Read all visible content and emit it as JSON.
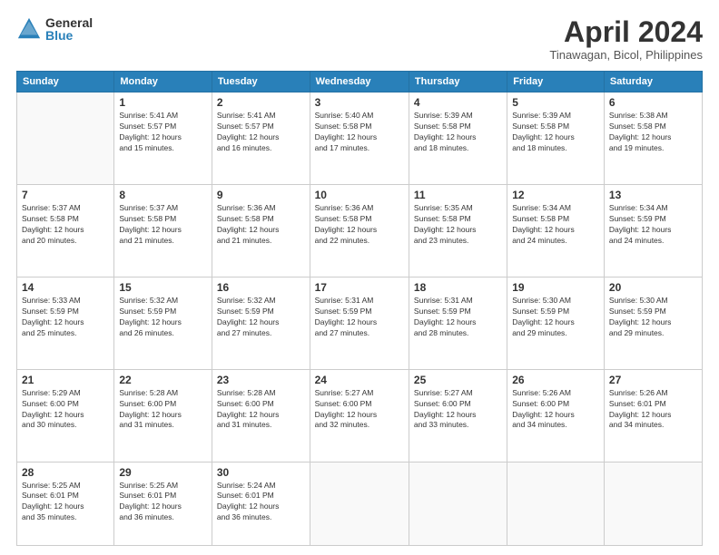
{
  "logo": {
    "general": "General",
    "blue": "Blue"
  },
  "title": "April 2024",
  "location": "Tinawagan, Bicol, Philippines",
  "days_of_week": [
    "Sunday",
    "Monday",
    "Tuesday",
    "Wednesday",
    "Thursday",
    "Friday",
    "Saturday"
  ],
  "weeks": [
    [
      {
        "day": "",
        "info": ""
      },
      {
        "day": "1",
        "info": "Sunrise: 5:41 AM\nSunset: 5:57 PM\nDaylight: 12 hours\nand 15 minutes."
      },
      {
        "day": "2",
        "info": "Sunrise: 5:41 AM\nSunset: 5:57 PM\nDaylight: 12 hours\nand 16 minutes."
      },
      {
        "day": "3",
        "info": "Sunrise: 5:40 AM\nSunset: 5:58 PM\nDaylight: 12 hours\nand 17 minutes."
      },
      {
        "day": "4",
        "info": "Sunrise: 5:39 AM\nSunset: 5:58 PM\nDaylight: 12 hours\nand 18 minutes."
      },
      {
        "day": "5",
        "info": "Sunrise: 5:39 AM\nSunset: 5:58 PM\nDaylight: 12 hours\nand 18 minutes."
      },
      {
        "day": "6",
        "info": "Sunrise: 5:38 AM\nSunset: 5:58 PM\nDaylight: 12 hours\nand 19 minutes."
      }
    ],
    [
      {
        "day": "7",
        "info": "Sunrise: 5:37 AM\nSunset: 5:58 PM\nDaylight: 12 hours\nand 20 minutes."
      },
      {
        "day": "8",
        "info": "Sunrise: 5:37 AM\nSunset: 5:58 PM\nDaylight: 12 hours\nand 21 minutes."
      },
      {
        "day": "9",
        "info": "Sunrise: 5:36 AM\nSunset: 5:58 PM\nDaylight: 12 hours\nand 21 minutes."
      },
      {
        "day": "10",
        "info": "Sunrise: 5:36 AM\nSunset: 5:58 PM\nDaylight: 12 hours\nand 22 minutes."
      },
      {
        "day": "11",
        "info": "Sunrise: 5:35 AM\nSunset: 5:58 PM\nDaylight: 12 hours\nand 23 minutes."
      },
      {
        "day": "12",
        "info": "Sunrise: 5:34 AM\nSunset: 5:58 PM\nDaylight: 12 hours\nand 24 minutes."
      },
      {
        "day": "13",
        "info": "Sunrise: 5:34 AM\nSunset: 5:59 PM\nDaylight: 12 hours\nand 24 minutes."
      }
    ],
    [
      {
        "day": "14",
        "info": "Sunrise: 5:33 AM\nSunset: 5:59 PM\nDaylight: 12 hours\nand 25 minutes."
      },
      {
        "day": "15",
        "info": "Sunrise: 5:32 AM\nSunset: 5:59 PM\nDaylight: 12 hours\nand 26 minutes."
      },
      {
        "day": "16",
        "info": "Sunrise: 5:32 AM\nSunset: 5:59 PM\nDaylight: 12 hours\nand 27 minutes."
      },
      {
        "day": "17",
        "info": "Sunrise: 5:31 AM\nSunset: 5:59 PM\nDaylight: 12 hours\nand 27 minutes."
      },
      {
        "day": "18",
        "info": "Sunrise: 5:31 AM\nSunset: 5:59 PM\nDaylight: 12 hours\nand 28 minutes."
      },
      {
        "day": "19",
        "info": "Sunrise: 5:30 AM\nSunset: 5:59 PM\nDaylight: 12 hours\nand 29 minutes."
      },
      {
        "day": "20",
        "info": "Sunrise: 5:30 AM\nSunset: 5:59 PM\nDaylight: 12 hours\nand 29 minutes."
      }
    ],
    [
      {
        "day": "21",
        "info": "Sunrise: 5:29 AM\nSunset: 6:00 PM\nDaylight: 12 hours\nand 30 minutes."
      },
      {
        "day": "22",
        "info": "Sunrise: 5:28 AM\nSunset: 6:00 PM\nDaylight: 12 hours\nand 31 minutes."
      },
      {
        "day": "23",
        "info": "Sunrise: 5:28 AM\nSunset: 6:00 PM\nDaylight: 12 hours\nand 31 minutes."
      },
      {
        "day": "24",
        "info": "Sunrise: 5:27 AM\nSunset: 6:00 PM\nDaylight: 12 hours\nand 32 minutes."
      },
      {
        "day": "25",
        "info": "Sunrise: 5:27 AM\nSunset: 6:00 PM\nDaylight: 12 hours\nand 33 minutes."
      },
      {
        "day": "26",
        "info": "Sunrise: 5:26 AM\nSunset: 6:00 PM\nDaylight: 12 hours\nand 34 minutes."
      },
      {
        "day": "27",
        "info": "Sunrise: 5:26 AM\nSunset: 6:01 PM\nDaylight: 12 hours\nand 34 minutes."
      }
    ],
    [
      {
        "day": "28",
        "info": "Sunrise: 5:25 AM\nSunset: 6:01 PM\nDaylight: 12 hours\nand 35 minutes."
      },
      {
        "day": "29",
        "info": "Sunrise: 5:25 AM\nSunset: 6:01 PM\nDaylight: 12 hours\nand 36 minutes."
      },
      {
        "day": "30",
        "info": "Sunrise: 5:24 AM\nSunset: 6:01 PM\nDaylight: 12 hours\nand 36 minutes."
      },
      {
        "day": "",
        "info": ""
      },
      {
        "day": "",
        "info": ""
      },
      {
        "day": "",
        "info": ""
      },
      {
        "day": "",
        "info": ""
      }
    ]
  ]
}
